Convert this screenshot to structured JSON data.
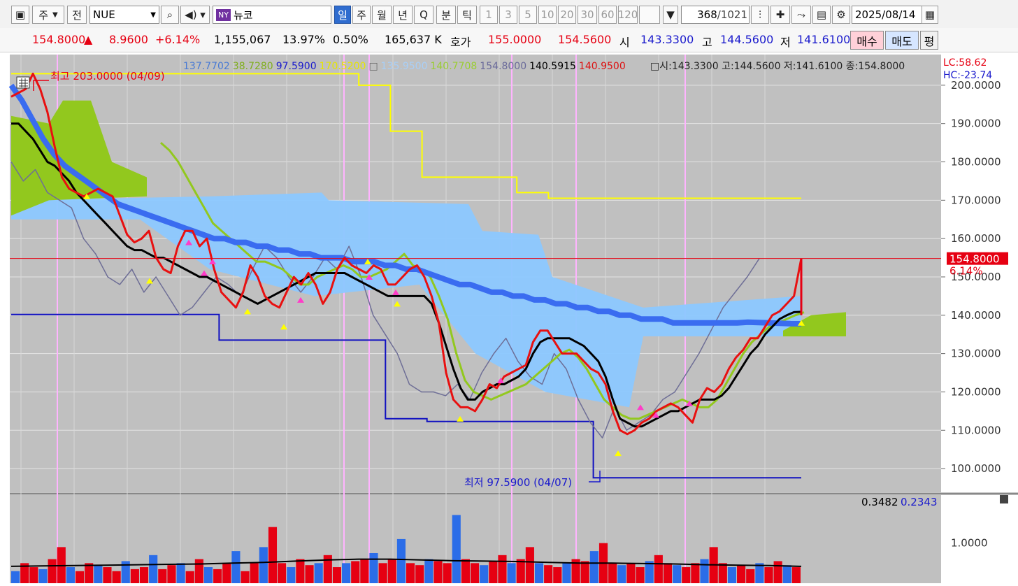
{
  "toolbar": {
    "period_code": "주",
    "prev_label": "전",
    "ticker": "NUE",
    "exchange_badge": "NY",
    "name": "뉴코",
    "tabs": [
      "일",
      "주",
      "월",
      "년",
      "Q",
      "분",
      "틱"
    ],
    "active_tab": "일",
    "intervals": [
      "1",
      "3",
      "5",
      "10",
      "20",
      "30",
      "60",
      "120"
    ],
    "count": "368",
    "total": "/1021",
    "date": "2025/08/14"
  },
  "quote": {
    "price": "154.8000",
    "arrow": "▲",
    "change": "8.9600",
    "change_pct": "+6.14%",
    "volume": "1,155,067",
    "turnover_pct": "13.97%",
    "ratio_pct": "0.50%",
    "amount": "165,637 K",
    "ask_label": "호가",
    "ask": "155.0000",
    "bid": "154.5600",
    "open_label": "시",
    "open": "143.3300",
    "high_label": "고",
    "high": "144.5600",
    "low_label": "저",
    "low": "141.6100",
    "buy_label": "매수",
    "sell_label": "매도",
    "avg_label": "평"
  },
  "legend": {
    "values": [
      {
        "text": "137.7702",
        "color": "#4a7bd4"
      },
      {
        "text": "38.7280",
        "color": "#7fae1c"
      },
      {
        "text": "97.5900",
        "color": "#1a1acc"
      },
      {
        "text": "170.5200",
        "color": "#e6e600"
      },
      {
        "text": "□",
        "color": "#666666"
      },
      {
        "text": "135.9500",
        "color": "#a8cff8"
      },
      {
        "text": "140.7708",
        "color": "#9acd32"
      },
      {
        "text": "154.8000",
        "color": "#6a6a9a"
      },
      {
        "text": "140.5915",
        "color": "#000000"
      },
      {
        "text": "140.9500",
        "color": "#dd1111"
      }
    ],
    "ohlc": "□시:143.3300 고:144.5600 저:141.6100 종:154.8000",
    "lc": "LC:58.62",
    "hc": "HC:-23.74"
  },
  "colors": {
    "up": "#e60012",
    "down": "#2b6de8",
    "plot_bg": "#c0c0c0",
    "cloud": "#8cc8ff",
    "cloud_green": "#92c81e",
    "ma_black": "#000000",
    "ma_thick_blue": "#3a6cf0",
    "conversion_red": "#e81010",
    "lagging_gray": "#6e6e96",
    "lagging_green": "#92c81e",
    "resist_yellow": "#ffff00",
    "support_blue": "#1111c0",
    "marker_pink": "#ff3cc8",
    "marker_yellow": "#ffff00",
    "vline": "#ffb4ff"
  },
  "chart_data": {
    "type": "line",
    "price_axis": {
      "ylim": [
        94,
        208
      ],
      "ticks": [
        "200.0000",
        "190.0000",
        "180.0000",
        "170.0000",
        "160.0000",
        "150.0000",
        "140.0000",
        "130.0000",
        "120.0000",
        "110.0000",
        "100.0000"
      ],
      "tick_values": [
        200,
        190,
        180,
        170,
        160,
        150,
        140,
        130,
        120,
        110,
        100
      ]
    },
    "current_price": {
      "value": 154.8,
      "label": "154.8000",
      "pct": "6.14%"
    },
    "annotations": {
      "high": {
        "text": "최고 203.0000 (04/09)",
        "value": 203.0
      },
      "low": {
        "text": "최저 97.5900 (04/07)",
        "value": 97.59
      }
    },
    "series": [
      {
        "name": "종가",
        "color": "#e81010",
        "values": [
          197,
          198,
          199,
          203,
          199,
          193,
          184,
          176,
          173,
          172,
          171,
          172,
          173,
          172,
          171,
          166,
          161,
          159,
          160,
          162,
          155,
          152,
          151,
          158,
          162,
          162,
          158,
          160,
          152,
          146,
          144,
          142,
          146,
          153,
          150,
          145,
          143,
          142,
          146,
          150,
          148,
          151,
          148,
          143,
          146,
          152,
          155,
          153,
          152,
          151,
          153,
          152,
          148,
          148,
          150,
          152,
          153,
          150,
          145,
          138,
          125,
          118,
          116,
          116,
          115,
          118,
          122,
          121,
          124,
          125,
          126,
          127,
          133,
          136,
          136,
          133,
          130,
          130,
          130,
          128,
          126,
          125,
          122,
          115,
          110,
          109,
          110,
          112,
          113,
          115,
          116,
          117,
          116,
          114,
          112,
          118,
          121,
          120,
          122,
          126,
          129,
          131,
          134,
          134,
          137,
          140,
          141,
          143,
          145,
          154.8
        ]
      },
      {
        "name": "기준선",
        "color": "#000000",
        "values": [
          190,
          190,
          188,
          186,
          183,
          180,
          179,
          177,
          175,
          172,
          170,
          168,
          166,
          164,
          162,
          160,
          158,
          157,
          157,
          156,
          155,
          155,
          154,
          153,
          152,
          151,
          150,
          150,
          149,
          148,
          147,
          146,
          145,
          144,
          143,
          144,
          145,
          146,
          147,
          148,
          149,
          150,
          151,
          151,
          151,
          151,
          151,
          150,
          149,
          148,
          147,
          146,
          145,
          145,
          145,
          145,
          145,
          145,
          143,
          138,
          132,
          126,
          121,
          118,
          118,
          120,
          121,
          122,
          122,
          123,
          124,
          126,
          130,
          133,
          134,
          134,
          134,
          134,
          133,
          132,
          130,
          128,
          124,
          118,
          113,
          112,
          111,
          111,
          112,
          113,
          114,
          115,
          115,
          116,
          117,
          118,
          118,
          118,
          119,
          121,
          124,
          127,
          130,
          132,
          135,
          137,
          139,
          140,
          140.8,
          140.9
        ]
      },
      {
        "name": "이동평균(굵은)",
        "color": "#3a6cf0",
        "values": [
          200,
          196,
          191,
          186,
          182,
          179,
          177,
          175,
          173,
          171,
          169,
          168,
          167,
          166,
          165,
          164,
          163,
          162,
          161,
          160,
          160,
          159,
          159,
          158,
          158,
          157,
          157,
          156,
          156,
          155,
          155,
          155,
          154,
          154,
          154,
          153,
          153,
          152,
          152,
          151,
          150,
          149,
          148,
          148,
          147,
          146,
          146,
          145,
          145,
          144,
          144,
          143,
          143,
          142,
          142,
          141,
          141,
          140,
          140,
          139,
          139,
          139,
          138,
          138,
          138,
          138,
          138,
          138,
          138,
          138.2,
          138.1,
          138,
          137.9,
          137.8,
          137.77
        ]
      },
      {
        "name": "후행스팬",
        "color": "#6e6e96",
        "values": [
          180,
          175,
          178,
          172,
          170,
          168,
          160,
          156,
          150,
          148,
          152,
          146,
          150,
          145,
          140,
          142,
          146,
          150,
          148,
          145,
          152,
          158,
          155,
          150,
          146,
          150,
          155,
          152,
          158,
          150,
          140,
          135,
          130,
          122,
          120,
          120,
          119,
          122,
          118,
          125,
          130,
          134,
          128,
          124,
          122,
          130,
          126,
          118,
          112,
          108,
          116,
          110,
          112,
          114,
          118,
          120,
          125,
          130,
          136,
          142,
          146,
          150,
          154.8
        ]
      },
      {
        "name": "선행스팬1",
        "color": "#92c81e",
        "values": [
          185,
          183,
          180,
          176,
          172,
          168,
          164,
          162,
          160,
          158,
          156,
          154,
          154,
          153,
          152,
          150,
          148,
          148,
          150,
          151,
          152,
          153,
          152,
          150,
          150,
          151,
          152,
          154,
          156,
          153,
          152,
          150,
          145,
          139,
          130,
          123,
          120,
          119,
          118,
          119,
          120,
          121,
          122,
          124,
          126,
          128,
          130,
          131,
          129,
          126,
          122,
          118,
          116,
          114,
          113,
          113,
          114,
          115,
          116,
          117,
          118,
          117,
          116,
          116,
          118,
          122,
          126,
          130,
          133,
          135,
          137,
          138,
          139,
          140,
          140.77
        ]
      },
      {
        "name": "저항선",
        "color": "#ffff00",
        "values": [
          203,
          203,
          203,
          203,
          203,
          203,
          203,
          203,
          203,
          203,
          203,
          200,
          188,
          176,
          176,
          176,
          172,
          170.52,
          170.52,
          170.52,
          170.52,
          170.52,
          170.52,
          170.52,
          170.52,
          170.52
        ]
      },
      {
        "name": "지지선",
        "color": "#1111c0",
        "values": [
          140.2,
          140.2,
          140.2,
          140.2,
          140.2,
          133.5,
          133.5,
          133.5,
          133.5,
          113,
          112.3,
          112.3,
          112.3,
          112.3,
          97.59,
          97.59,
          97.59,
          97.59,
          97.59,
          97.59
        ]
      }
    ],
    "volume_panel": {
      "label_values": [
        "0.3482",
        "0.2343"
      ],
      "tick": "1.0000",
      "tick_value": 1.0,
      "bars": [
        0.3,
        0.5,
        0.4,
        0.35,
        0.6,
        0.9,
        0.4,
        0.3,
        0.5,
        0.45,
        0.4,
        0.3,
        0.55,
        0.35,
        0.4,
        0.7,
        0.35,
        0.45,
        0.5,
        0.3,
        0.6,
        0.4,
        0.35,
        0.5,
        0.8,
        0.3,
        0.5,
        0.9,
        1.4,
        0.5,
        0.4,
        0.6,
        0.45,
        0.5,
        0.7,
        0.4,
        0.5,
        0.55,
        0.6,
        0.75,
        0.5,
        0.6,
        1.1,
        0.5,
        0.45,
        0.6,
        0.55,
        0.5,
        1.7,
        0.6,
        0.5,
        0.45,
        0.55,
        0.7,
        0.5,
        0.6,
        0.9,
        0.5,
        0.45,
        0.4,
        0.5,
        0.6,
        0.55,
        0.8,
        1.0,
        0.5,
        0.45,
        0.5,
        0.4,
        0.55,
        0.7,
        0.5,
        0.45,
        0.4,
        0.5,
        0.6,
        0.9,
        0.5,
        0.4,
        0.45,
        0.35,
        0.5,
        0.4,
        0.55,
        0.45,
        0.4
      ],
      "ma": [
        0.42,
        0.43,
        0.44,
        0.45,
        0.46,
        0.47,
        0.48,
        0.5,
        0.52,
        0.55,
        0.58,
        0.6,
        0.6,
        0.58,
        0.56,
        0.55,
        0.54,
        0.52,
        0.5,
        0.5,
        0.49,
        0.48,
        0.46,
        0.45,
        0.44,
        0.42
      ]
    }
  }
}
